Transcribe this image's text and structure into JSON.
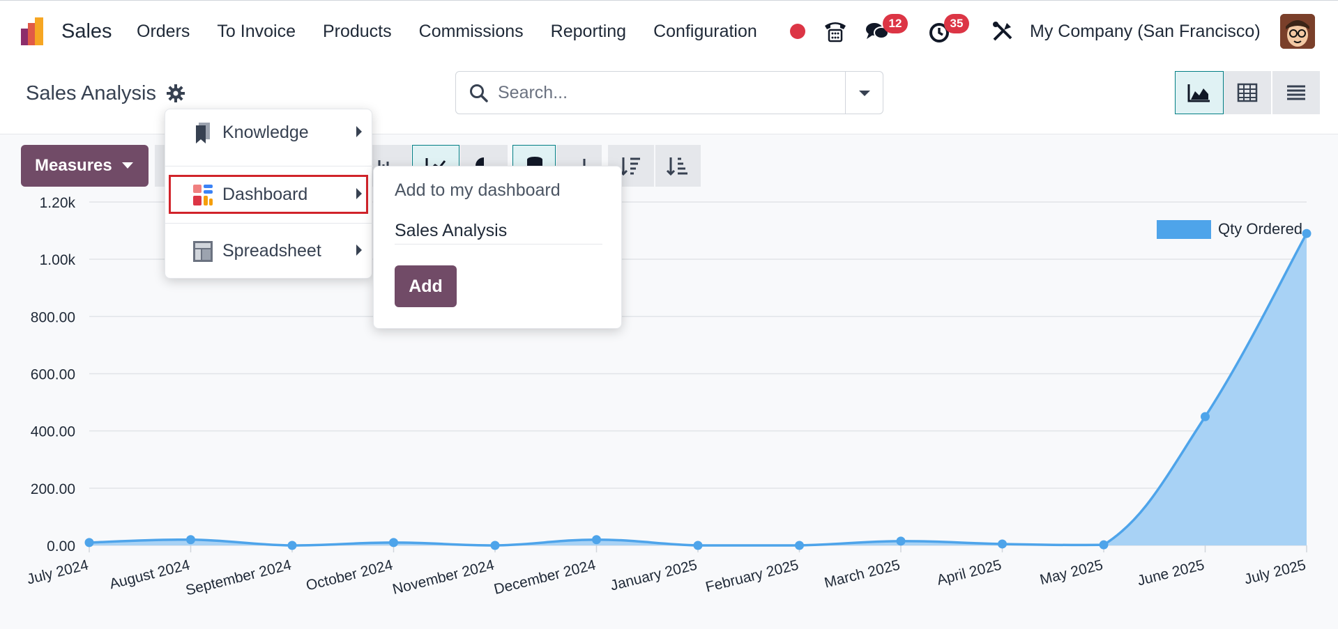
{
  "app": {
    "name": "Sales"
  },
  "menu": [
    "Orders",
    "To Invoice",
    "Products",
    "Commissions",
    "Reporting",
    "Configuration"
  ],
  "systray": {
    "messages_count": "12",
    "activities_count": "35",
    "company": "My Company (San Francisco)"
  },
  "control_panel": {
    "title": "Sales Analysis",
    "search_placeholder": "Search..."
  },
  "toolbar": {
    "measures_label": "Measures"
  },
  "cog_menu": {
    "items": [
      {
        "label": "Knowledge",
        "icon": "knowledge-icon"
      },
      {
        "label": "Dashboard",
        "icon": "dashboard-icon"
      },
      {
        "label": "Spreadsheet",
        "icon": "spreadsheet-icon"
      }
    ]
  },
  "dashboard_submenu": {
    "heading": "Add to my dashboard",
    "name_value": "Sales Analysis",
    "add_label": "Add"
  },
  "colors": {
    "brand": "#714b67",
    "accent": "#017e84",
    "series": "#4ea4ea",
    "badge": "#dc3545"
  },
  "chart_data": {
    "type": "area",
    "categories": [
      "July 2024",
      "August 2024",
      "September 2024",
      "October 2024",
      "November 2024",
      "December 2024",
      "January 2025",
      "February 2025",
      "March 2025",
      "April 2025",
      "May 2025",
      "June 2025",
      "July 2025"
    ],
    "series": [
      {
        "name": "Qty Ordered",
        "values": [
          10,
          20,
          0,
          10,
          0,
          20,
          0,
          0,
          15,
          5,
          2,
          450,
          1090
        ]
      }
    ],
    "yticks": [
      "0.00",
      "200.00",
      "400.00",
      "600.00",
      "800.00",
      "1.00k",
      "1.20k"
    ],
    "ylim": [
      0,
      1200
    ],
    "grid": true,
    "legend": "top-right"
  }
}
